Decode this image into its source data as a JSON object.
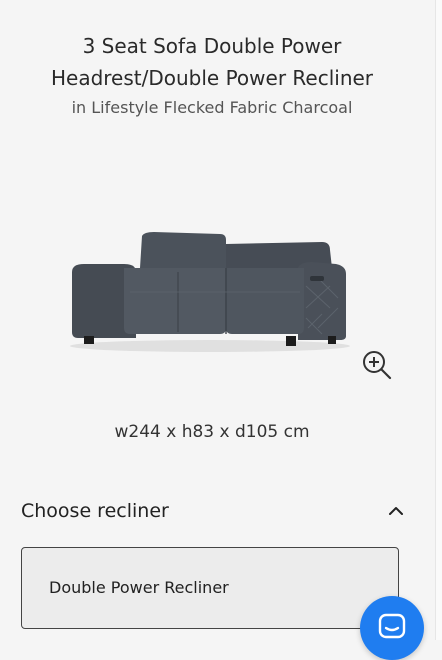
{
  "product": {
    "title_line1": "3 Seat Sofa Double Power",
    "title_line2": "Headrest/Double Power Recliner",
    "subtitle": "in Lifestyle Flecked Fabric Charcoal",
    "dimensions": "w244 x h83 x d105 cm"
  },
  "recliner_section": {
    "title": "Choose recliner",
    "selected_option": "Double Power Recliner"
  },
  "icons": {
    "zoom": "zoom-in-icon",
    "chevron": "chevron-up-icon",
    "chat": "chat-icon"
  },
  "colors": {
    "sofa": "#4a5058",
    "chat_button": "#1f7df0",
    "background": "#f5f5f5"
  }
}
